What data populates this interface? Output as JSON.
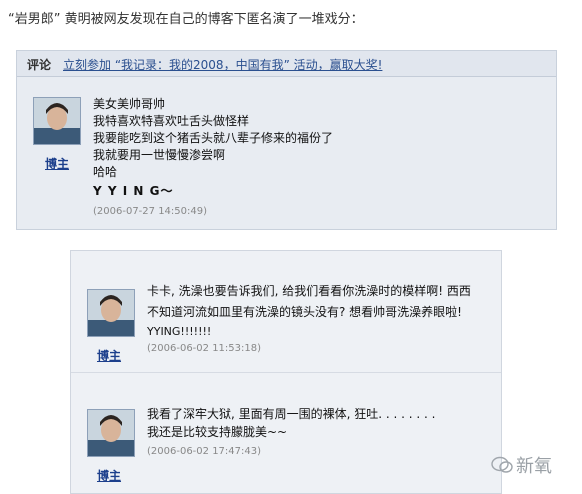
{
  "headline": "“岩男郎” 黄明被网友发现在自己的博客下匿名演了一堆戏分：",
  "panel1": {
    "bar_label": "评论",
    "bar_link": "立刻参加 “我记录：我的2008，中国有我” 活动，赢取大奖!",
    "comment": {
      "role": "博主",
      "lines": [
        "美女美帅哥帅",
        "我特喜欢特喜欢吐舌头做怪样",
        "我要能吃到这个猪舌头就八辈子修来的福份了",
        "我就要用一世慢慢渗尝啊",
        "哈哈",
        "Y Y I N G～"
      ],
      "time": "(2006-07-27 14:50:49)"
    }
  },
  "panel2": {
    "comments": [
      {
        "role": "博主",
        "lines": [
          "卡卡, 洗澡也要告诉我们, 给我们看看你洗澡时的模样啊! 西西",
          "不知道河流如皿里有洗澡的镜头没有? 想看帅哥洗澡养眼啦!",
          "YYING!!!!!!!"
        ],
        "time": "(2006-06-02 11:53:18)"
      },
      {
        "role": "博主",
        "lines": [
          "我看了深牢大狱, 里面有周一围的裸体, 狂吐. . . . . . . .",
          "我还是比较支持朦胧美~~"
        ],
        "time": "(2006-06-02 17:47:43)"
      }
    ]
  },
  "watermark": "新氧",
  "icons": {
    "avatar": "portrait-avatar-icon",
    "watermark": "wechat-watermark-icon"
  },
  "colors": {
    "link": "#2a4f8f",
    "badge": "#1c3f8c",
    "panel": "#e8ecf2",
    "timestamp": "#888888"
  }
}
